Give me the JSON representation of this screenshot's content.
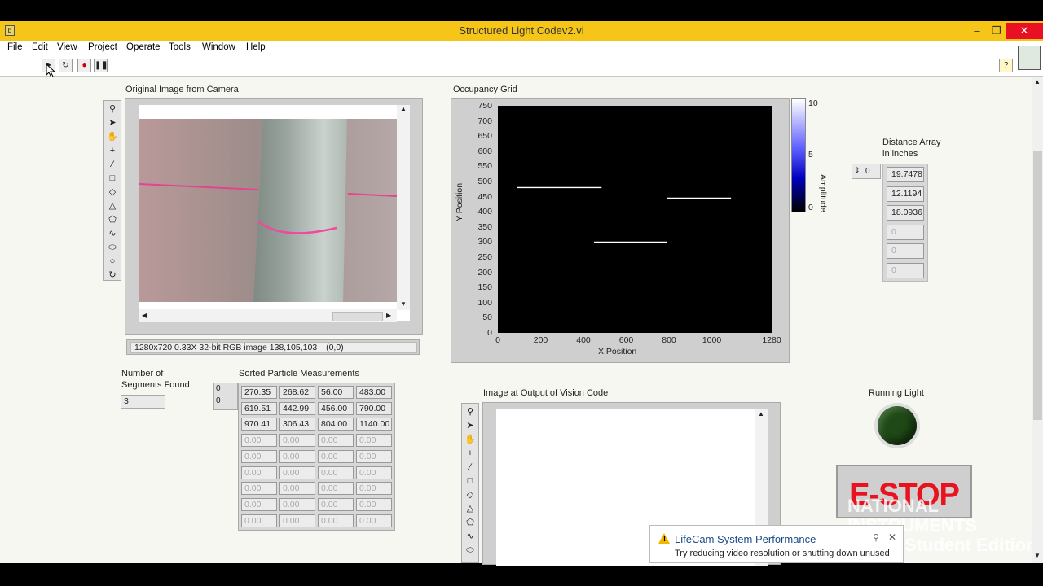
{
  "window": {
    "title": "Structured Light Codev2.vi",
    "app_icon": "labview-vi-icon",
    "controls": [
      "minimize",
      "maximize",
      "close"
    ]
  },
  "menu": [
    "File",
    "Edit",
    "View",
    "Project",
    "Operate",
    "Tools",
    "Window",
    "Help"
  ],
  "toolbar": {
    "buttons": [
      "run-arrow",
      "run-continuously",
      "abort-execution",
      "pause"
    ],
    "help_label": "?"
  },
  "camera_display": {
    "label": "Original Image from Camera",
    "status": "1280x720 0.33X 32-bit RGB image 138,105,103",
    "coords": "(0,0)"
  },
  "occupancy_grid": {
    "label": "Occupancy Grid",
    "colorbar_label": "Amplitude",
    "colorbar_ticks": [
      "10",
      "5",
      "0"
    ],
    "chart_data": {
      "type": "scatter",
      "title": "",
      "xlabel": "X Position",
      "ylabel": "Y Position",
      "xlim": [
        0,
        1280
      ],
      "ylim": [
        0,
        750
      ],
      "x_ticks": [
        "0",
        "200",
        "400",
        "600",
        "800",
        "1000",
        "1280"
      ],
      "y_ticks": [
        "750",
        "700",
        "650",
        "600",
        "550",
        "500",
        "450",
        "400",
        "350",
        "300",
        "250",
        "200",
        "150",
        "100",
        "50",
        "0"
      ],
      "segments": [
        {
          "x_start": 90,
          "x_end": 485,
          "y": 480
        },
        {
          "x_start": 450,
          "x_end": 790,
          "y": 300
        },
        {
          "x_start": 790,
          "x_end": 1090,
          "y": 445
        }
      ]
    }
  },
  "segments_found": {
    "label_line1": "Number of",
    "label_line2": "Segments Found",
    "value": "3"
  },
  "particle_table": {
    "label": "Sorted Particle Measurements",
    "index_row": "0",
    "index_col": "0",
    "rows": [
      [
        "270.35",
        "268.62",
        "56.00",
        "483.00"
      ],
      [
        "619.51",
        "442.99",
        "456.00",
        "790.00"
      ],
      [
        "970.41",
        "306.43",
        "804.00",
        "1140.00"
      ],
      [
        "0.00",
        "0.00",
        "0.00",
        "0.00"
      ],
      [
        "0.00",
        "0.00",
        "0.00",
        "0.00"
      ],
      [
        "0.00",
        "0.00",
        "0.00",
        "0.00"
      ],
      [
        "0.00",
        "0.00",
        "0.00",
        "0.00"
      ],
      [
        "0.00",
        "0.00",
        "0.00",
        "0.00"
      ],
      [
        "0.00",
        "0.00",
        "0.00",
        "0.00"
      ]
    ]
  },
  "distance_array": {
    "label_line1": "Distance Array",
    "label_line2": "in inches",
    "index": "0",
    "values": [
      "19.7478",
      "12.1194",
      "18.0936",
      "0",
      "0",
      "0"
    ]
  },
  "output_display": {
    "label": "Image at Output of Vision Code"
  },
  "running_light": {
    "label": "Running Light",
    "color": "#1f4a17"
  },
  "estop": {
    "label": "E-STOP",
    "color": "#e8131e"
  },
  "notification": {
    "title": "LifeCam System Performance",
    "body": "Try reducing video resolution or shutting down unused"
  },
  "watermark": {
    "line1": "NATIONAL",
    "line2": "INSTRUMENTS",
    "line3": "Student Edition"
  }
}
